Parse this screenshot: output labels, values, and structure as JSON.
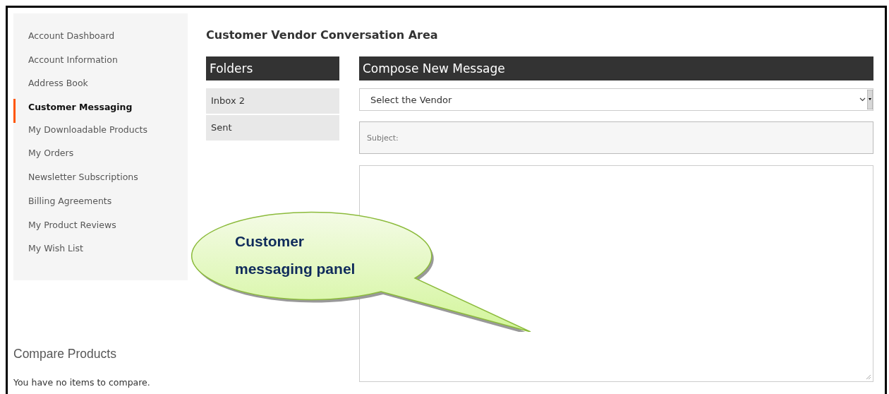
{
  "sidebar": {
    "items": [
      {
        "label": "Account Dashboard",
        "selected": false
      },
      {
        "label": "Account Information",
        "selected": false
      },
      {
        "label": "Address Book",
        "selected": false
      },
      {
        "label": "Customer Messaging",
        "selected": true
      },
      {
        "label": "My Downloadable Products",
        "selected": false
      },
      {
        "label": "My Orders",
        "selected": false
      },
      {
        "label": "Newsletter Subscriptions",
        "selected": false
      },
      {
        "label": "Billing Agreements",
        "selected": false
      },
      {
        "label": "My Product Reviews",
        "selected": false
      },
      {
        "label": "My Wish List",
        "selected": false
      }
    ]
  },
  "compare": {
    "title": "Compare Products",
    "message": "You have no items to compare."
  },
  "page_title": "Customer Vendor Conversation Area",
  "folders": {
    "title": "Folders",
    "items": [
      {
        "label": "Inbox 2"
      },
      {
        "label": "Sent"
      }
    ]
  },
  "compose": {
    "title": "Compose New Message",
    "vendor_select": {
      "value": "Select the Vendor"
    },
    "subject": {
      "placeholder": "Subject:"
    }
  },
  "callout": {
    "text": "Customer messaging panel"
  }
}
